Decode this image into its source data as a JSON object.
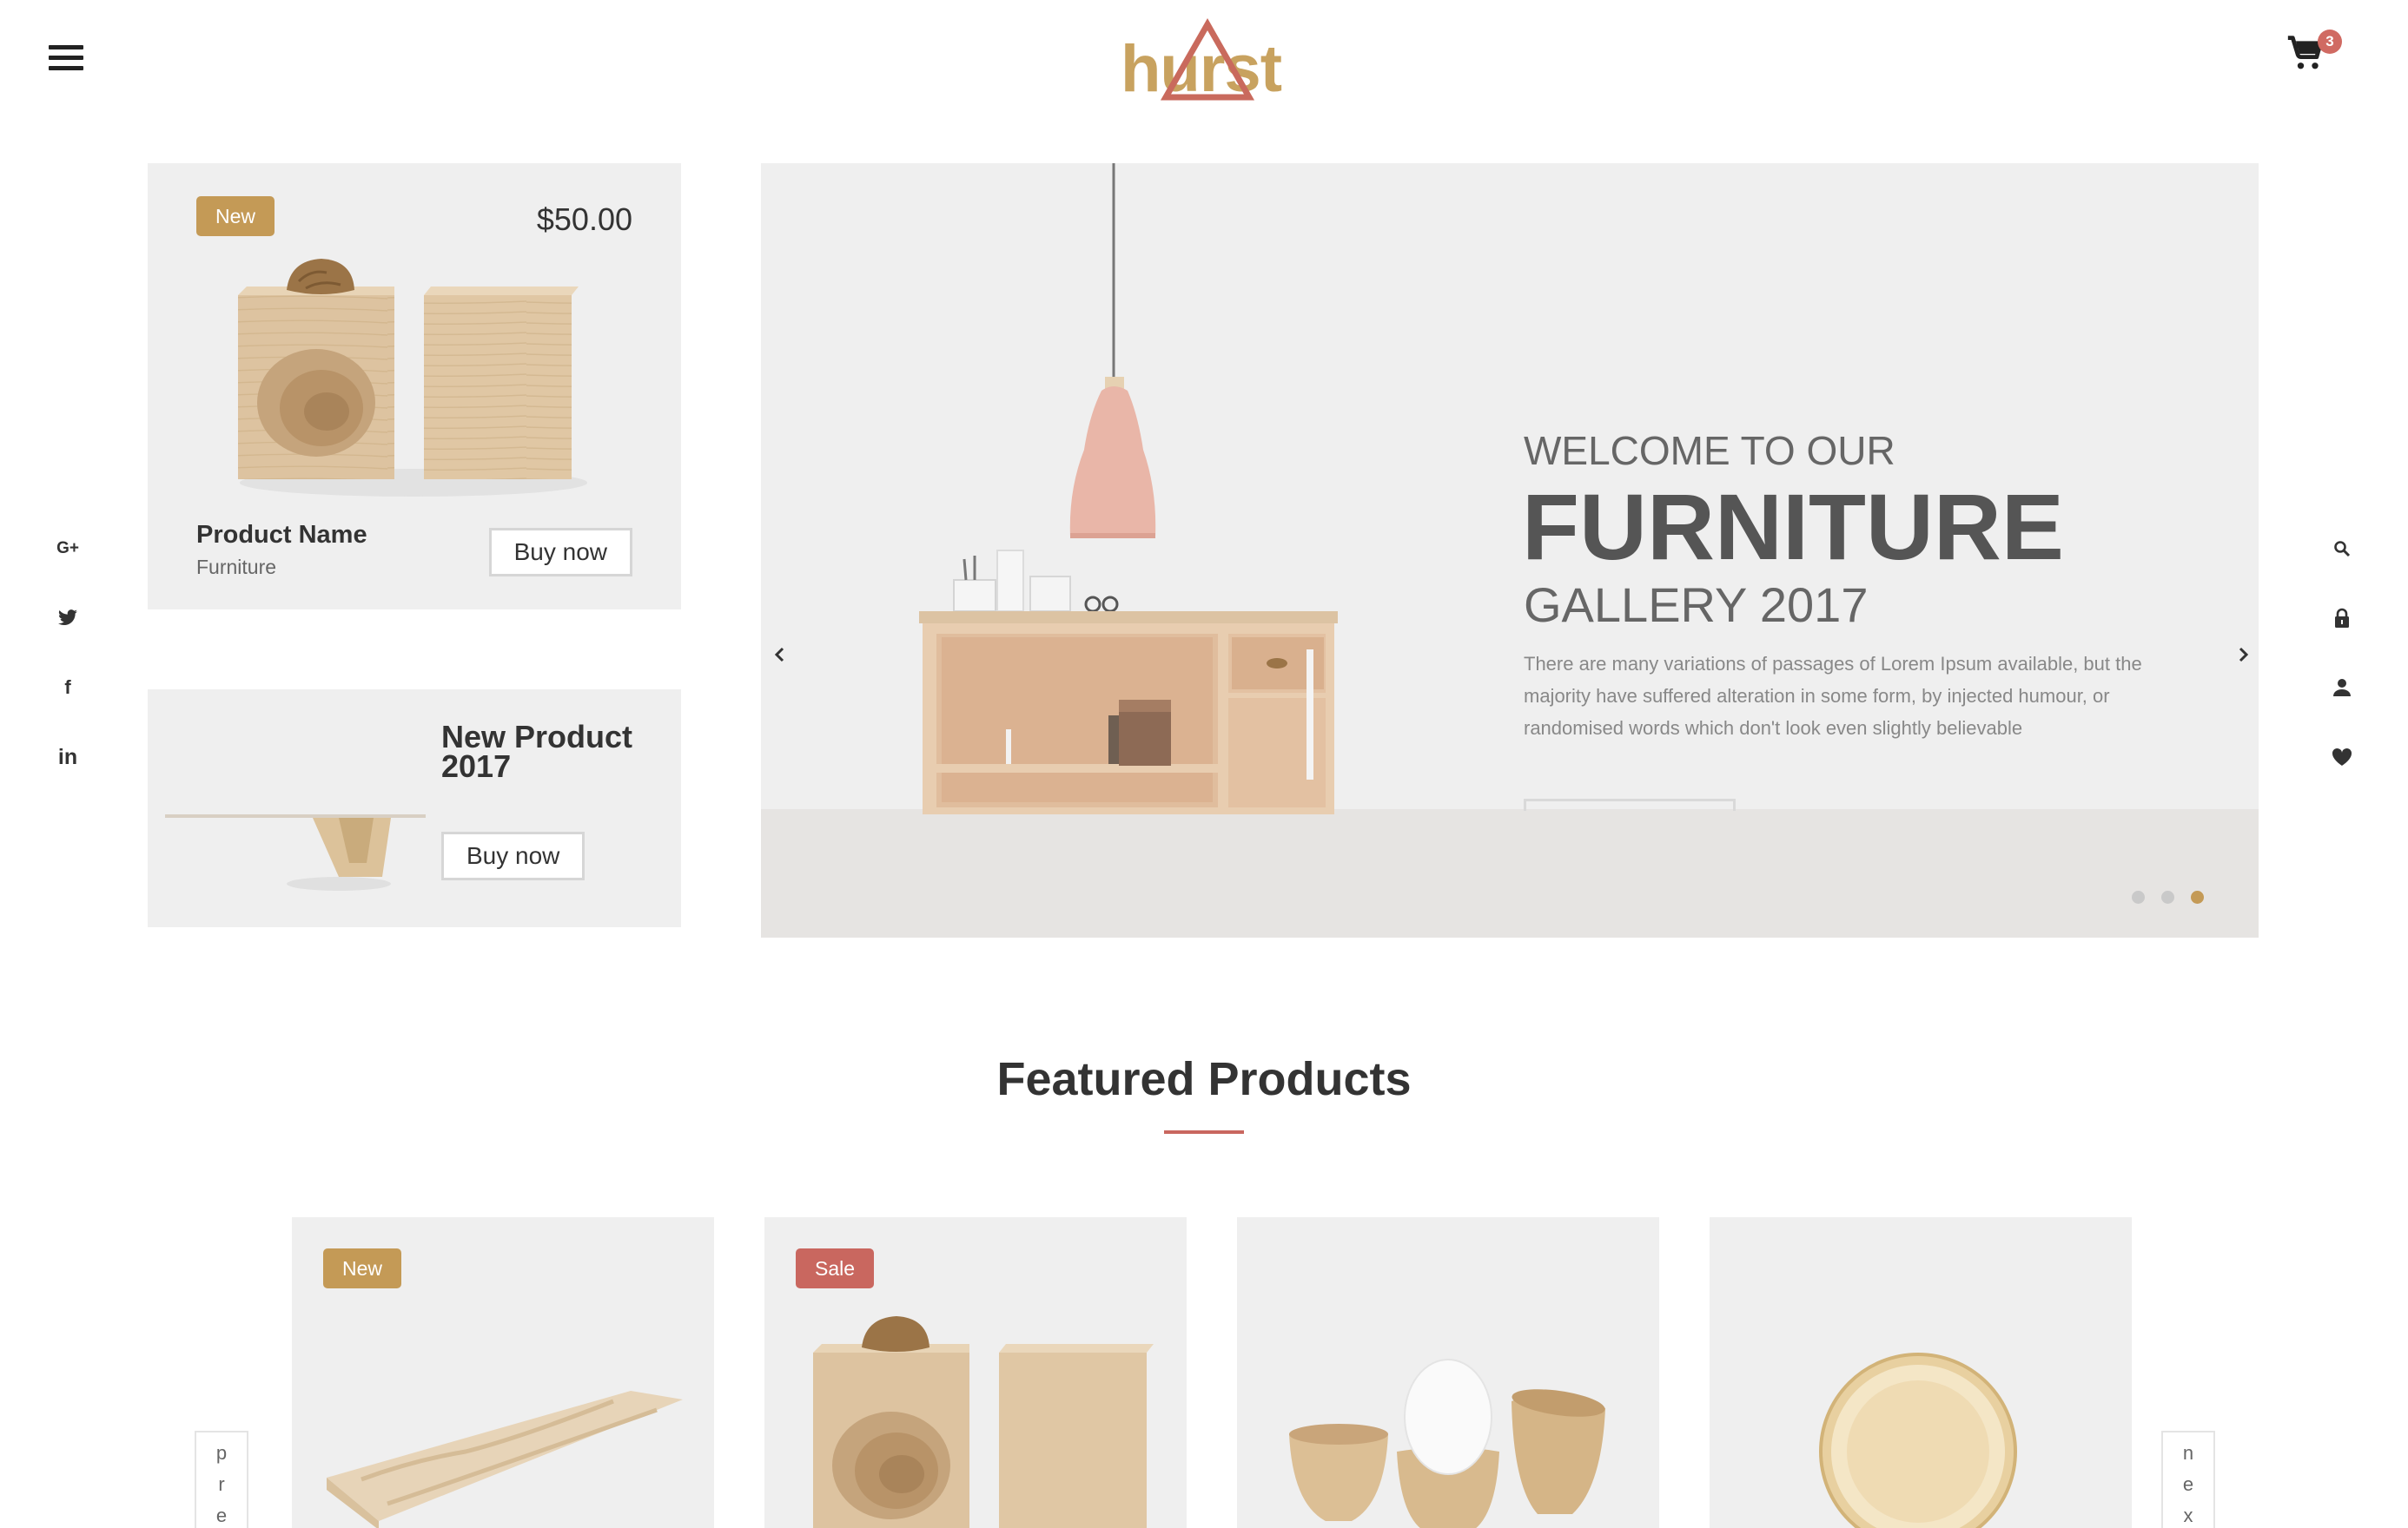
{
  "header": {
    "logo_text": "hurst",
    "cart_count": "3"
  },
  "social": [
    {
      "name": "google-plus",
      "label": "G+"
    },
    {
      "name": "twitter",
      "label": ""
    },
    {
      "name": "facebook",
      "label": "f"
    },
    {
      "name": "linkedin",
      "label": "in"
    }
  ],
  "tools": [
    "search",
    "lock",
    "user",
    "heart"
  ],
  "card1": {
    "badge": "New",
    "price": "$50.00",
    "name": "Product Name",
    "category": "Furniture",
    "button": "Buy now"
  },
  "card2": {
    "title": "New Product 2017",
    "button": "Buy now"
  },
  "hero": {
    "eyebrow": "WELCOME TO OUR",
    "title": "FURNITURE",
    "subtitle": "GALLERY 2017",
    "text": "There are many variations of passages of Lorem Ipsum available, but the majority have suffered alteration in some form, by injected humour, or randomised words which don't look even slightly believable",
    "slide_count": 3,
    "active_slide": 3
  },
  "featured": {
    "title": "Featured Products",
    "products": [
      {
        "badge": "New",
        "badge_type": "new"
      },
      {
        "badge": "Sale",
        "badge_type": "sale"
      },
      {
        "badge": "",
        "badge_type": ""
      },
      {
        "badge": "",
        "badge_type": ""
      }
    ],
    "prev_label": "pre",
    "next_label": "nex"
  },
  "colors": {
    "accent_gold": "#c49a56",
    "accent_red": "#c9675f",
    "panel": "#efefef"
  }
}
